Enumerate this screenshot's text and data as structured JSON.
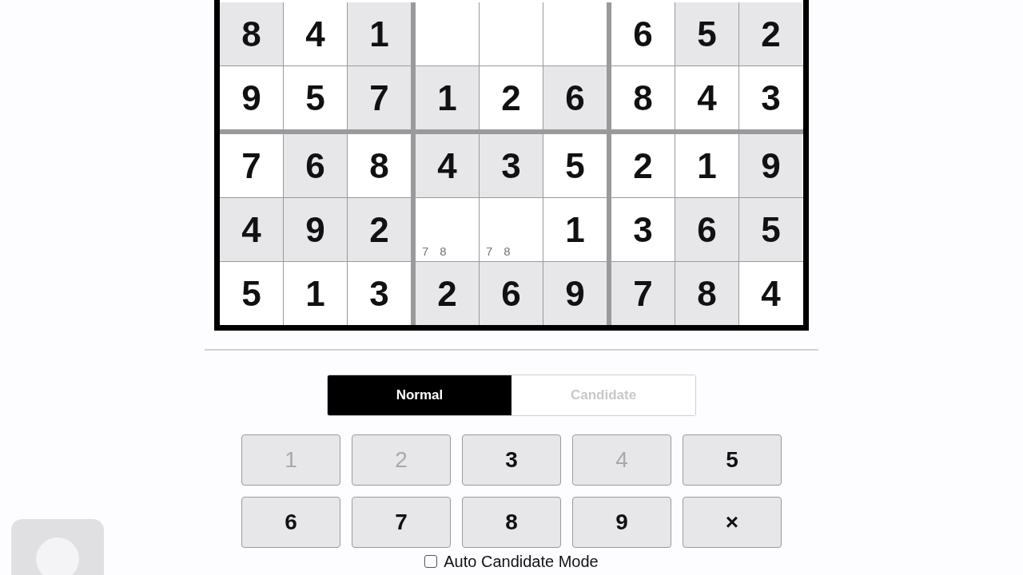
{
  "board": {
    "rows": [
      [
        {
          "value": "8",
          "shaded": true
        },
        {
          "value": "4",
          "shaded": false
        },
        {
          "value": "1",
          "shaded": true
        },
        {
          "shaded": false
        },
        {
          "shaded": false
        },
        {
          "shaded": false
        },
        {
          "value": "6",
          "shaded": false
        },
        {
          "value": "5",
          "shaded": true
        },
        {
          "value": "2",
          "shaded": true
        }
      ],
      [
        {
          "value": "9",
          "shaded": false
        },
        {
          "value": "5",
          "shaded": false
        },
        {
          "value": "7",
          "shaded": true
        },
        {
          "value": "1",
          "shaded": true
        },
        {
          "value": "2",
          "shaded": false
        },
        {
          "value": "6",
          "shaded": true
        },
        {
          "value": "8",
          "shaded": false
        },
        {
          "value": "4",
          "shaded": false
        },
        {
          "value": "3",
          "shaded": false
        }
      ],
      [
        {
          "value": "7",
          "shaded": false
        },
        {
          "value": "6",
          "shaded": true
        },
        {
          "value": "8",
          "shaded": false
        },
        {
          "value": "4",
          "shaded": true
        },
        {
          "value": "3",
          "shaded": true
        },
        {
          "value": "5",
          "shaded": false
        },
        {
          "value": "2",
          "shaded": false
        },
        {
          "value": "1",
          "shaded": false
        },
        {
          "value": "9",
          "shaded": true
        }
      ],
      [
        {
          "value": "4",
          "shaded": true
        },
        {
          "value": "9",
          "shaded": true
        },
        {
          "value": "2",
          "shaded": true
        },
        {
          "candidates": [
            "7",
            "8"
          ],
          "shaded": false
        },
        {
          "candidates": [
            "7",
            "8"
          ],
          "shaded": false
        },
        {
          "value": "1",
          "shaded": false
        },
        {
          "value": "3",
          "shaded": false
        },
        {
          "value": "6",
          "shaded": true
        },
        {
          "value": "5",
          "shaded": true
        }
      ],
      [
        {
          "value": "5",
          "shaded": false
        },
        {
          "value": "1",
          "shaded": false
        },
        {
          "value": "3",
          "shaded": false
        },
        {
          "value": "2",
          "shaded": true
        },
        {
          "value": "6",
          "shaded": true
        },
        {
          "value": "9",
          "shaded": true
        },
        {
          "value": "7",
          "shaded": true
        },
        {
          "value": "8",
          "shaded": true
        },
        {
          "value": "4",
          "shaded": false
        }
      ]
    ]
  },
  "mode_tabs": [
    {
      "label": "Normal",
      "selected": true
    },
    {
      "label": "Candidate",
      "selected": false
    }
  ],
  "keypad": [
    {
      "label": "1",
      "disabled": true
    },
    {
      "label": "2",
      "disabled": true
    },
    {
      "label": "3",
      "disabled": false
    },
    {
      "label": "4",
      "disabled": true
    },
    {
      "label": "5",
      "disabled": false
    },
    {
      "label": "6",
      "disabled": false
    },
    {
      "label": "7",
      "disabled": false
    },
    {
      "label": "8",
      "disabled": false
    },
    {
      "label": "9",
      "disabled": false
    },
    {
      "label": "×",
      "disabled": false
    }
  ],
  "auto_candidate": {
    "label": "Auto Candidate Mode",
    "checked": false
  }
}
